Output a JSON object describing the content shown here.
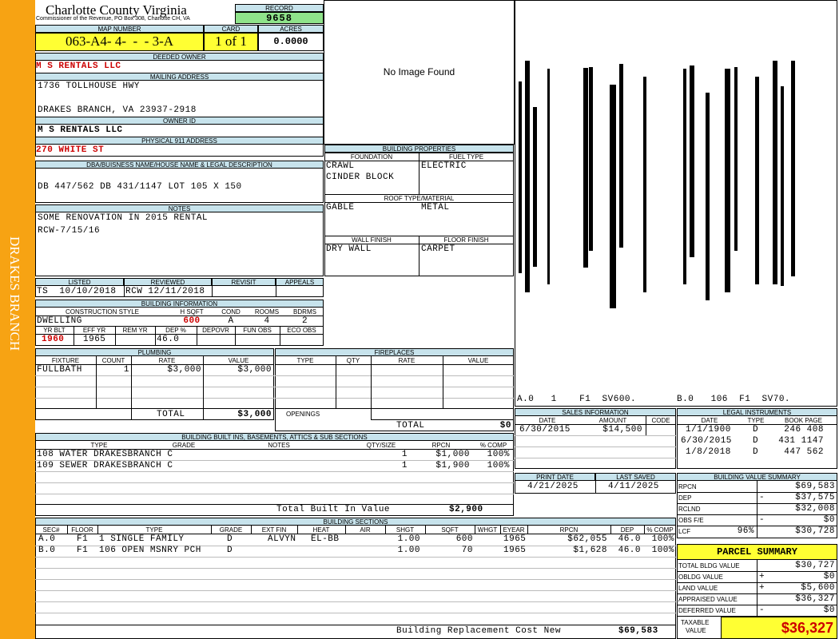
{
  "sidebar_label": "DRAKES BRANCH",
  "header": {
    "county": "Charlotte County Virginia",
    "office": "Commissioner of the Revenue, PO Box 308, Charlotte CH, VA"
  },
  "record": {
    "label": "RECORD",
    "value": "9658"
  },
  "map_number": {
    "label": "MAP NUMBER",
    "value": "063-A4- 4-  -  - 3-A"
  },
  "card": {
    "label": "CARD",
    "value": "1 of 1"
  },
  "acres": {
    "label": "ACRES",
    "value": "0.0000"
  },
  "deeded_owner": {
    "label": "DEEDED OWNER",
    "value": "M S RENTALS LLC"
  },
  "mailing_address": {
    "label": "MAILING ADDRESS",
    "line1": "1736 TOLLHOUSE HWY",
    "line2": "DRAKES BRANCH, VA 23937-2918"
  },
  "owner_id": {
    "label": "OWNER ID",
    "value": "M S RENTALS LLC"
  },
  "physical_address": {
    "label": "PHYSICAL 911 ADDRESS",
    "value": "270 WHITE ST"
  },
  "legal": {
    "label": "DBA/BUISNESS NAME/HOUSE NAME & LEGAL DESCRIPTION",
    "value": "DB 447/562 DB 431/1147 LOT 105 X 150"
  },
  "notes": {
    "label": "NOTES",
    "line1": "SOME RENOVATION IN 2015 RENTAL",
    "line2": "RCW-7/15/16"
  },
  "photo": {
    "text": "No Image Found"
  },
  "building_properties": {
    "label": "BUILDING PROPERTIES",
    "foundation_label": "FOUNDATION",
    "fuel_label": "FUEL TYPE",
    "foundation1": "CRAWL",
    "foundation2": "CINDER BLOCK",
    "fuel": "ELECTRIC",
    "roof_label": "ROOF TYPE/MATERIAL",
    "roof_type": "GABLE",
    "roof_material": "METAL",
    "wall_label": "WALL FINISH",
    "floor_label": "FLOOR FINISH",
    "wall": "DRY WALL",
    "floor": "CARPET"
  },
  "sketch_labels": {
    "a": "A.0   1    F1  SV600.",
    "b": "B.0   106  F1  SV70."
  },
  "review": {
    "listed_label": "LISTED",
    "reviewed_label": "REVIEWED",
    "revisit_label": "REVISIT",
    "appeals_label": "APPEALS",
    "listed": "TS  10/10/2018",
    "reviewed": "RCW 12/11/2018"
  },
  "building_info": {
    "label": "BUILDING INFORMATION",
    "h_style": "CONSTRUCTION STYLE",
    "h_hsqft": "H SQFT",
    "h_cond": "COND",
    "h_rooms": "ROOMS",
    "h_bdrms": "BDRMS",
    "style": "DWELLING",
    "hsqft": "600",
    "cond": "A",
    "rooms": "4",
    "bdrms": "2",
    "h_yrblt": "YR BLT",
    "h_effyr": "EFF YR",
    "h_remyr": "REM YR",
    "h_dep": "DEP %",
    "h_depovr": "DEPOVR",
    "h_funobs": "FUN OBS",
    "h_ecoobs": "ECO OBS",
    "yrblt": "1960",
    "effyr": "1965",
    "dep": "46.0"
  },
  "plumbing": {
    "label": "PLUMBING",
    "h_fixture": "FIXTURE",
    "h_count": "COUNT",
    "h_rate": "RATE",
    "h_value": "VALUE",
    "fixture": "FULLBATH",
    "count": "1",
    "rate": "$3,000",
    "value": "$3,000",
    "total_label": "TOTAL",
    "total": "$3,000"
  },
  "fireplaces": {
    "label": "FIREPLACES",
    "h_type": "TYPE",
    "h_qty": "QTY",
    "h_rate": "RATE",
    "h_value": "VALUE",
    "openings_label": "OPENINGS",
    "total_label": "TOTAL",
    "total": "$0"
  },
  "sales": {
    "label": "SALES INFORMATION",
    "h_date": "DATE",
    "h_amount": "AMOUNT",
    "h_code": "CODE",
    "date": "6/30/2015",
    "amount": "$14,500"
  },
  "legal_instruments": {
    "label": "LEGAL INSTRUMENTS",
    "h_date": "DATE",
    "h_type": "TYPE",
    "h_bookpage": "BOOK PAGE",
    "rows": [
      {
        "date": "1/1/1900",
        "type": "D",
        "book": "246 408"
      },
      {
        "date": "6/30/2015",
        "type": "D",
        "book": "431 1147"
      },
      {
        "date": "1/8/2018",
        "type": "D",
        "book": "447 562"
      }
    ]
  },
  "builtins": {
    "label": "BUILDING BUILT INS, BASEMENTS, ATTICS & SUB SECTIONS",
    "h_type": "TYPE",
    "h_grade": "GRADE",
    "h_notes": "NOTES",
    "h_qty": "QTY/SIZE",
    "h_rpcn": "RPCN",
    "h_comp": "% COMP",
    "rows": [
      {
        "type": "108 WATER DRAKESBRANCH C",
        "qty": "1",
        "rpcn": "$1,000",
        "comp": "100%"
      },
      {
        "type": "109 SEWER DRAKESBRANCH C",
        "qty": "1",
        "rpcn": "$1,900",
        "comp": "100%"
      }
    ],
    "total_label": "Total Built In Value",
    "total": "$2,900"
  },
  "dates": {
    "print_label": "PRINT DATE",
    "saved_label": "LAST SAVED",
    "print": "4/21/2025",
    "saved": "4/11/2025"
  },
  "bvs": {
    "label": "BUILDING VALUE SUMMARY",
    "rows": [
      {
        "label": "RPCN",
        "sign": "",
        "value": "$69,583"
      },
      {
        "label": "DEP",
        "sign": "-",
        "value": "$37,575"
      },
      {
        "label": "RCLND",
        "sign": "",
        "value": "$32,008"
      },
      {
        "label": "OBS F/E",
        "sign": "-",
        "value": "$0"
      },
      {
        "label": "LCF",
        "pct": "96%",
        "sign": "",
        "value": "$30,728"
      }
    ]
  },
  "sections": {
    "label": "BUILDING SECTIONS",
    "headers": [
      "SEC#",
      "FLOOR",
      "TYPE",
      "GRADE",
      "EXT FIN",
      "HEAT",
      "AIR",
      "SHGT",
      "SQFT",
      "WHGT",
      "EYEAR",
      "RPCN",
      "DEP",
      "% COMP"
    ],
    "rows": [
      {
        "sec": "A.0",
        "floor": "F1",
        "type": "1 SINGLE FAMILY",
        "grade": "D",
        "ext": "ALVYN",
        "heat": "EL-BB",
        "shgt": "1.00",
        "sqft": "600",
        "eyear": "1965",
        "rpcn": "$62,055",
        "dep": "46.0",
        "comp": "100%"
      },
      {
        "sec": "B.0",
        "floor": "F1",
        "type": "106 OPEN MSNRY PCH",
        "grade": "D",
        "ext": "",
        "heat": "",
        "shgt": "1.00",
        "sqft": "70",
        "eyear": "1965",
        "rpcn": "$1,628",
        "dep": "46.0",
        "comp": "100%"
      }
    ],
    "total_label": "Building Replacement Cost New",
    "total": "$69,583"
  },
  "parcel": {
    "label": "PARCEL SUMMARY",
    "rows": [
      {
        "label": "TOTAL BLDG VALUE",
        "sign": "",
        "value": "$30,727"
      },
      {
        "label": "OBLDG VALUE",
        "sign": "+",
        "value": "$0"
      },
      {
        "label": "LAND VALUE",
        "sign": "+",
        "value": "$5,600"
      },
      {
        "label": "APPRAISED VALUE",
        "sign": "",
        "value": "$36,327"
      },
      {
        "label": "DEFERRED VALUE",
        "sign": "-",
        "value": "$0"
      }
    ],
    "taxable_label1": "TAXABLE",
    "taxable_label2": "VALUE",
    "taxable": "$36,327"
  },
  "colors": {
    "sidebar": "#f7a313",
    "header_blue": "#c7e3ec",
    "highlight_yellow": "#ffff33",
    "record_green": "#8fe38a",
    "red_text": "#cc0000"
  }
}
